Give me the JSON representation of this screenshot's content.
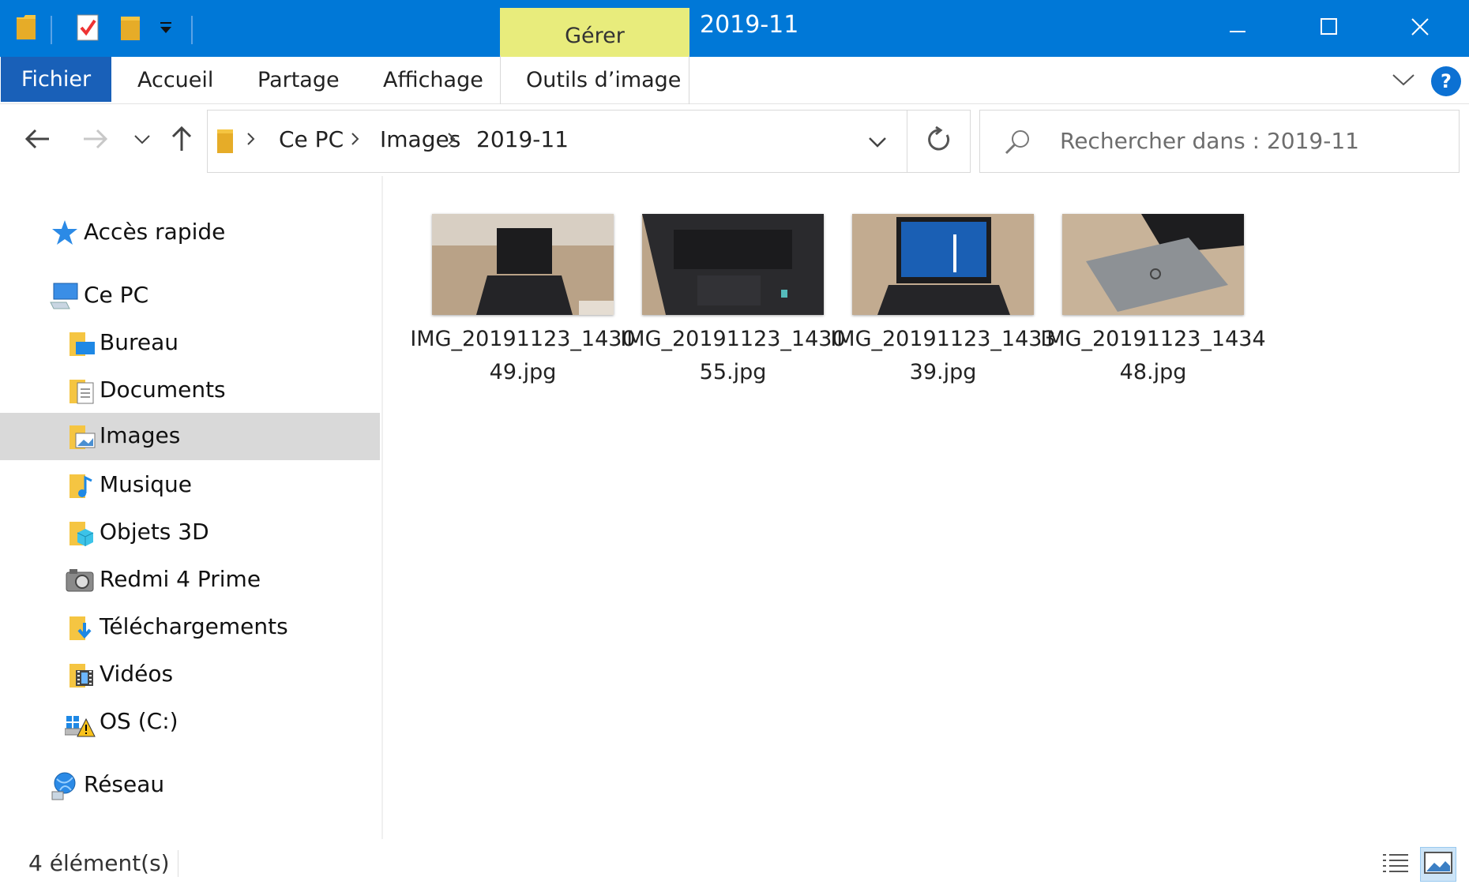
{
  "window": {
    "title": "2019-11",
    "contextual_tab": "Gérer",
    "accent_color": "#0078d7",
    "contextual_color": "#e8ec7c"
  },
  "ribbon": {
    "file_tab": "Fichier",
    "tabs": [
      "Accueil",
      "Partage",
      "Affichage"
    ],
    "contextual_tab": "Outils d’image",
    "help": "?"
  },
  "address": {
    "crumbs": [
      "Ce PC",
      "Images",
      "2019-11"
    ],
    "search_placeholder": "Rechercher dans : 2019-11"
  },
  "nav": {
    "items": [
      {
        "label": "Accès rapide",
        "icon": "star-icon"
      },
      {
        "label": "Ce PC",
        "icon": "computer-icon"
      },
      {
        "label": "Bureau",
        "icon": "desktop-folder-icon"
      },
      {
        "label": "Documents",
        "icon": "documents-folder-icon"
      },
      {
        "label": "Images",
        "icon": "pictures-folder-icon",
        "selected": true
      },
      {
        "label": "Musique",
        "icon": "music-folder-icon"
      },
      {
        "label": "Objets 3D",
        "icon": "3d-objects-folder-icon"
      },
      {
        "label": "Redmi 4 Prime",
        "icon": "camera-device-icon"
      },
      {
        "label": "Téléchargements",
        "icon": "downloads-folder-icon"
      },
      {
        "label": "Vidéos",
        "icon": "videos-folder-icon"
      },
      {
        "label": "OS (C:)",
        "icon": "drive-warning-icon"
      },
      {
        "label": "Réseau",
        "icon": "network-icon"
      }
    ]
  },
  "files": [
    {
      "name": "IMG_20191123_143049.jpg"
    },
    {
      "name": "IMG_20191123_143055.jpg"
    },
    {
      "name": "IMG_20191123_143339.jpg"
    },
    {
      "name": "IMG_20191123_143448.jpg"
    }
  ],
  "status": {
    "count": "4 élément(s)"
  }
}
